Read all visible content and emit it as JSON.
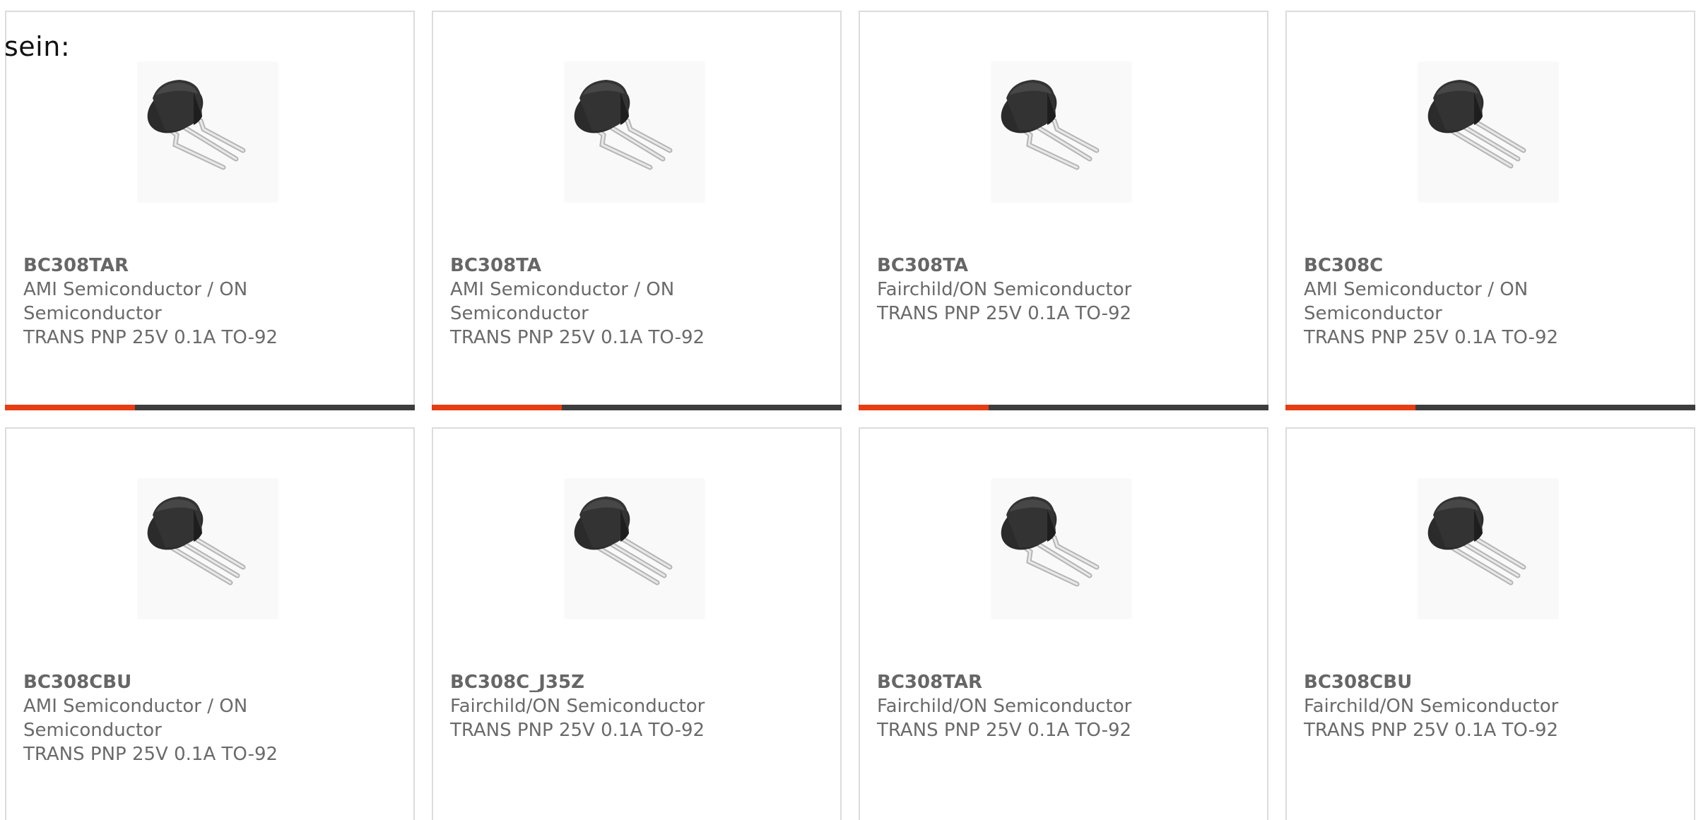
{
  "intro_text": "sein:",
  "colors": {
    "accent": "#e63d12",
    "bar_dark": "#3d3d3d",
    "card_border": "#dcdcdc",
    "text": "#6a6a6a"
  },
  "products": [
    {
      "part": "BC308TAR",
      "manufacturer": "AMI Semiconductor / ON Semiconductor",
      "description": "TRANS PNP 25V 0.1A TO-92",
      "image_icon": "to92-transistor-bent-leads-icon"
    },
    {
      "part": "BC308TA",
      "manufacturer": "AMI Semiconductor / ON Semiconductor",
      "description": "TRANS PNP 25V 0.1A TO-92",
      "image_icon": "to92-transistor-bent-leads-icon"
    },
    {
      "part": "BC308TA",
      "manufacturer": "Fairchild/ON Semiconductor",
      "description": "TRANS PNP 25V 0.1A TO-92",
      "image_icon": "to92-transistor-bent-leads-icon"
    },
    {
      "part": "BC308C",
      "manufacturer": "AMI Semiconductor / ON Semiconductor",
      "description": "TRANS PNP 25V 0.1A TO-92",
      "image_icon": "to92-transistor-straight-leads-icon"
    },
    {
      "part": "BC308CBU",
      "manufacturer": "AMI Semiconductor / ON Semiconductor",
      "description": "TRANS PNP 25V 0.1A TO-92",
      "image_icon": "to92-transistor-straight-leads-icon"
    },
    {
      "part": "BC308C_J35Z",
      "manufacturer": "Fairchild/ON Semiconductor",
      "description": "TRANS PNP 25V 0.1A TO-92",
      "image_icon": "to92-transistor-straight-leads-icon"
    },
    {
      "part": "BC308TAR",
      "manufacturer": "Fairchild/ON Semiconductor",
      "description": "TRANS PNP 25V 0.1A TO-92",
      "image_icon": "to92-transistor-bent-leads-icon"
    },
    {
      "part": "BC308CBU",
      "manufacturer": "Fairchild/ON Semiconductor",
      "description": "TRANS PNP 25V 0.1A TO-92",
      "image_icon": "to92-transistor-straight-leads-icon"
    }
  ]
}
